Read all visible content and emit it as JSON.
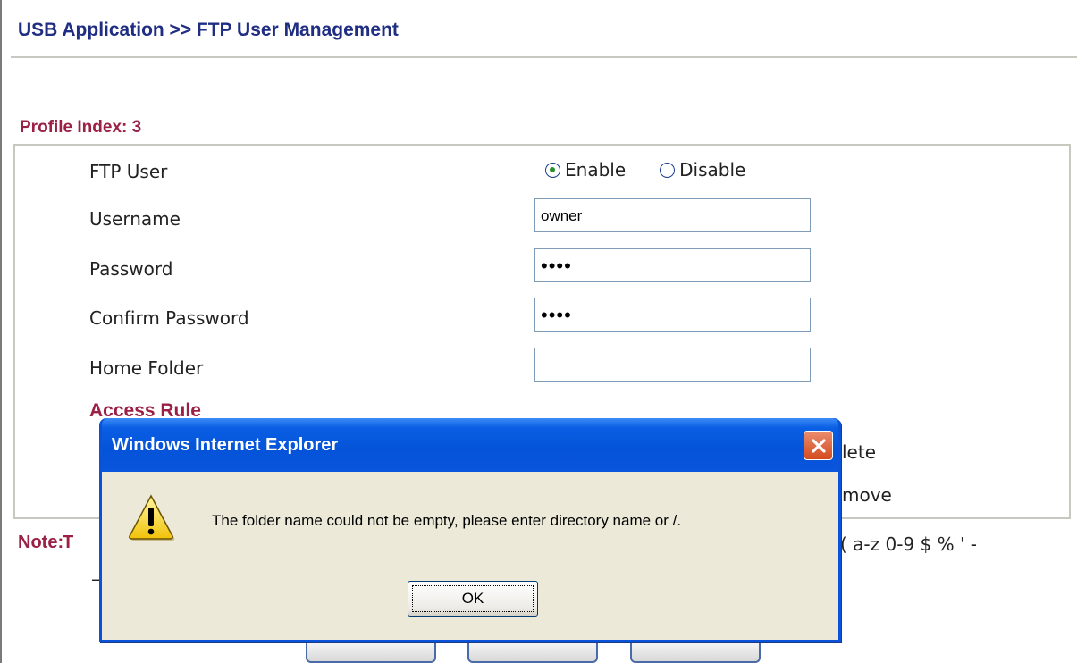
{
  "page": {
    "title": "USB Application >> FTP User Management",
    "profile_index": "Profile Index: 3"
  },
  "form": {
    "ftp_user_label": "FTP User",
    "enable_label": "Enable",
    "disable_label": "Disable",
    "ftp_user_state": "Enable",
    "username_label": "Username",
    "username_value": "owner",
    "password_label": "Password",
    "password_value": "••••",
    "confirm_label": "Confirm Password",
    "confirm_value": "••••",
    "home_folder_label": "Home Folder",
    "home_folder_value": "",
    "access_rule_label": "Access Rule"
  },
  "behind": {
    "delete_fragment": "lete",
    "remove_fragment": "move",
    "note_label": "Note:",
    "note_fragment": "T",
    "chars_fragment": "( a-z 0-9 $ % ' -",
    "dash_fragment": "–"
  },
  "dialog": {
    "title": "Windows Internet Explorer",
    "message": "The folder name could not be empty, please enter directory name or /.",
    "ok_label": "OK",
    "icon": "warning-icon",
    "title_color": "#0453d8",
    "close_color": "#d44a1e"
  },
  "colors": {
    "title": "#1f2d82",
    "section": "#9a2046"
  }
}
